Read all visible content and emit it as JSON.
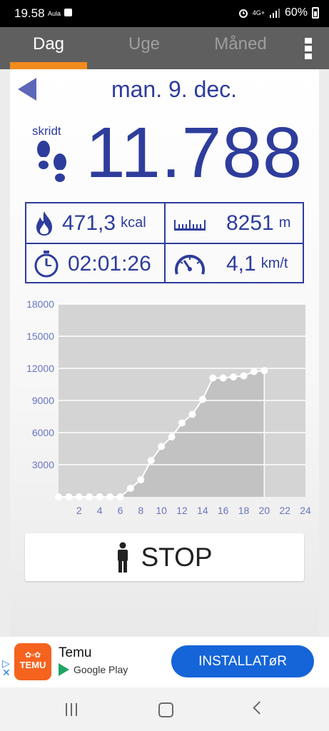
{
  "status_bar": {
    "time": "19.58",
    "carrier_small": "Aula",
    "network": "4G+",
    "battery": "60%"
  },
  "tabs": {
    "day": "Dag",
    "week": "Uge",
    "month": "Måned",
    "active": "Dag"
  },
  "header": {
    "date": "man. 9. dec."
  },
  "steps": {
    "label": "skridt",
    "value": "11.788"
  },
  "stats": {
    "calories": {
      "value": "471,3",
      "unit": "kcal"
    },
    "distance": {
      "value": "8251",
      "unit": "m"
    },
    "duration": {
      "value": "02:01:26"
    },
    "speed": {
      "value": "4,1",
      "unit": "km/t"
    }
  },
  "chart_data": {
    "type": "area",
    "x": [
      0,
      1,
      2,
      3,
      4,
      5,
      6,
      7,
      8,
      9,
      10,
      11,
      12,
      13,
      14,
      15,
      16,
      17,
      18,
      19,
      20
    ],
    "values": [
      0,
      0,
      0,
      0,
      0,
      0,
      0,
      800,
      1600,
      3400,
      4700,
      5600,
      6900,
      7700,
      9100,
      11100,
      11100,
      11200,
      11300,
      11700,
      11788
    ],
    "xlim": [
      0,
      24
    ],
    "ylim": [
      0,
      18000
    ],
    "x_ticks": [
      "2",
      "4",
      "6",
      "8",
      "10",
      "12",
      "14",
      "16",
      "18",
      "20",
      "22",
      "24"
    ],
    "y_ticks": [
      "3000",
      "6000",
      "9000",
      "12000",
      "15000",
      "18000"
    ],
    "grid": true,
    "colors": {
      "plot_bg": "#d4d4d4",
      "fill": "#c2c2c2",
      "line": "#ffffff",
      "tick_label": "#6a74c4"
    }
  },
  "stop_button": {
    "label": "STOP"
  },
  "ad": {
    "app_name": "Temu",
    "logo_text": "TEMU",
    "store": "Google Play",
    "cta": "INSTALLATøR"
  },
  "colors": {
    "accent": "#2e3d9c",
    "tab_underline": "#f28b1e",
    "tabbar": "#5f5f5f"
  }
}
